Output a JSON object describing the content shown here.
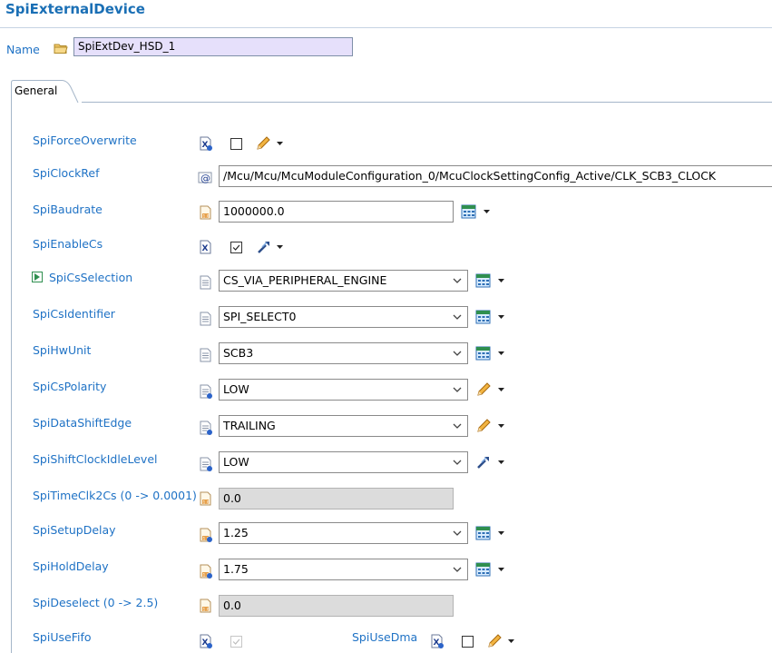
{
  "header": {
    "title": "SpiExternalDevice"
  },
  "name_row": {
    "label": "Name",
    "value": "SpiExtDev_HSD_1"
  },
  "tabs": [
    {
      "label": "General"
    }
  ],
  "fields": {
    "force_overwrite": {
      "label": "SpiForceOverwrite",
      "checked": false
    },
    "clock_ref": {
      "label": "SpiClockRef",
      "value": "/Mcu/Mcu/McuModuleConfiguration_0/McuClockSettingConfig_Active/CLK_SCB3_CLOCK"
    },
    "baudrate": {
      "label": "SpiBaudrate",
      "value": "1000000.0"
    },
    "enable_cs": {
      "label": "SpiEnableCs",
      "checked": true
    },
    "cs_selection": {
      "label": "SpiCsSelection",
      "value": "CS_VIA_PERIPHERAL_ENGINE"
    },
    "cs_identifier": {
      "label": "SpiCsIdentifier",
      "value": "SPI_SELECT0"
    },
    "hw_unit": {
      "label": "SpiHwUnit",
      "value": "SCB3"
    },
    "cs_polarity": {
      "label": "SpiCsPolarity",
      "value": "LOW"
    },
    "data_shift_edge": {
      "label": "SpiDataShiftEdge",
      "value": "TRAILING"
    },
    "shift_clock_idle_level": {
      "label": "SpiShiftClockIdleLevel",
      "value": "LOW"
    },
    "time_clk2cs": {
      "label": "SpiTimeClk2Cs (0 -> 0.0001)",
      "value": "0.0"
    },
    "setup_delay": {
      "label": "SpiSetupDelay",
      "value": "1.25"
    },
    "hold_delay": {
      "label": "SpiHoldDelay",
      "value": "1.75"
    },
    "deselect": {
      "label": "SpiDeselect (0 -> 2.5)",
      "value": "0.0"
    },
    "use_fifo": {
      "label": "SpiUseFifo",
      "checked": true
    },
    "use_dma": {
      "label": "SpiUseDma",
      "checked": false
    }
  },
  "colors": {
    "label_blue": "#1f72c5",
    "title_blue": "#1a6fb5",
    "name_bg": "#e6e0fb",
    "disabled_bg": "#dcdcdc"
  },
  "icons": [
    "folder-icon",
    "boolean-param-icon",
    "reference-param-icon",
    "float-param-icon",
    "enum-param-icon",
    "calculator-icon",
    "pencil-icon",
    "wand-icon",
    "expand-arrow-icon",
    "chevron-down-icon"
  ]
}
